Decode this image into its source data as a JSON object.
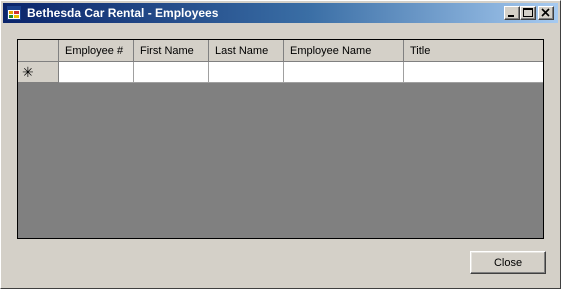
{
  "window": {
    "title": "Bethesda Car Rental - Employees",
    "icon": "app-window-icon",
    "controls": [
      "minimize",
      "maximize",
      "close"
    ]
  },
  "grid": {
    "columns": [
      "Employee #",
      "First Name",
      "Last Name",
      "Employee Name",
      "Title"
    ],
    "new_row_glyph": "✳",
    "rows": [],
    "background_color": "#808080"
  },
  "buttons": {
    "close_label": "Close"
  }
}
